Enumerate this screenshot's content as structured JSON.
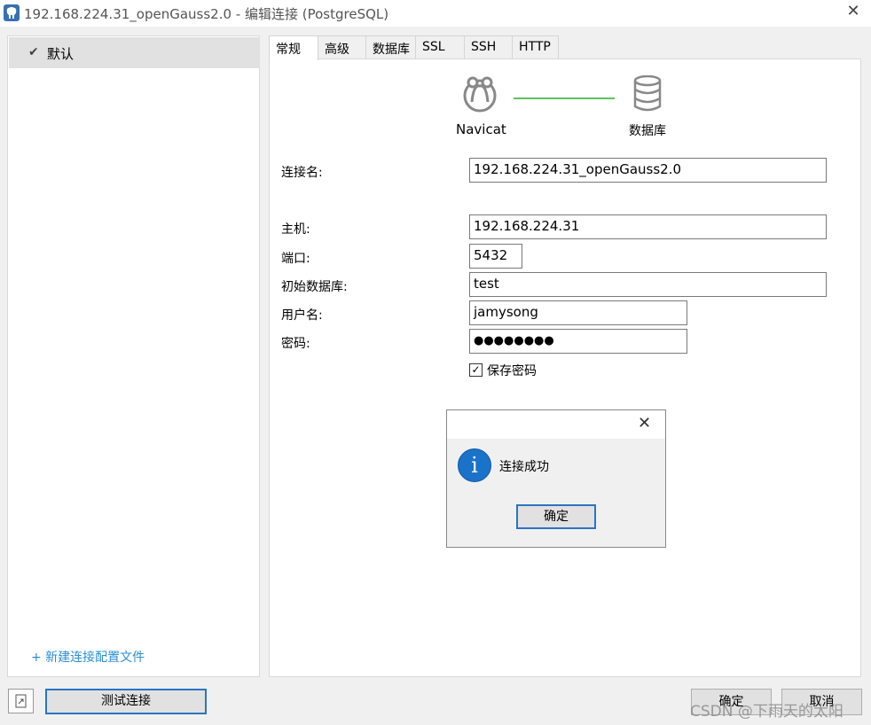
{
  "window": {
    "title": "192.168.224.31_openGauss2.0 - 编辑连接 (PostgreSQL)",
    "close_glyph": "✕"
  },
  "sidebar": {
    "profiles": [
      {
        "label": "默认",
        "selected": true
      }
    ],
    "new_profile_link": "+ 新建连接配置文件"
  },
  "tabs": [
    {
      "label": "常规",
      "active": true
    },
    {
      "label": "高级",
      "active": false
    },
    {
      "label": "数据库",
      "active": false
    },
    {
      "label": "SSL",
      "active": false
    },
    {
      "label": "SSH",
      "active": false
    },
    {
      "label": "HTTP",
      "active": false
    }
  ],
  "diagram": {
    "left_label": "Navicat",
    "right_label": "数据库",
    "line_color": "#5ec25e"
  },
  "form": {
    "connection_name": {
      "label": "连接名:",
      "value": "192.168.224.31_openGauss2.0"
    },
    "host": {
      "label": "主机:",
      "value": "192.168.224.31"
    },
    "port": {
      "label": "端口:",
      "value": "5432"
    },
    "initial_db": {
      "label": "初始数据库:",
      "value": "test"
    },
    "username": {
      "label": "用户名:",
      "value": "jamysong"
    },
    "password": {
      "label": "密码:",
      "value": "●●●●●●●●"
    },
    "save_password": {
      "label": "保存密码",
      "checked": true
    }
  },
  "message_box": {
    "text": "连接成功",
    "ok_label": "确定",
    "icon": "info-icon",
    "icon_glyph": "i",
    "close_glyph": "✕"
  },
  "footer": {
    "test_button": "测试连接",
    "ok_button": "确定",
    "cancel_button": "取消"
  },
  "watermark": "CSDN @下雨天的太阳",
  "colors": {
    "accent_blue": "#2a74c4",
    "link_blue": "#2b8fd2",
    "info_blue": "#1a73c8"
  }
}
